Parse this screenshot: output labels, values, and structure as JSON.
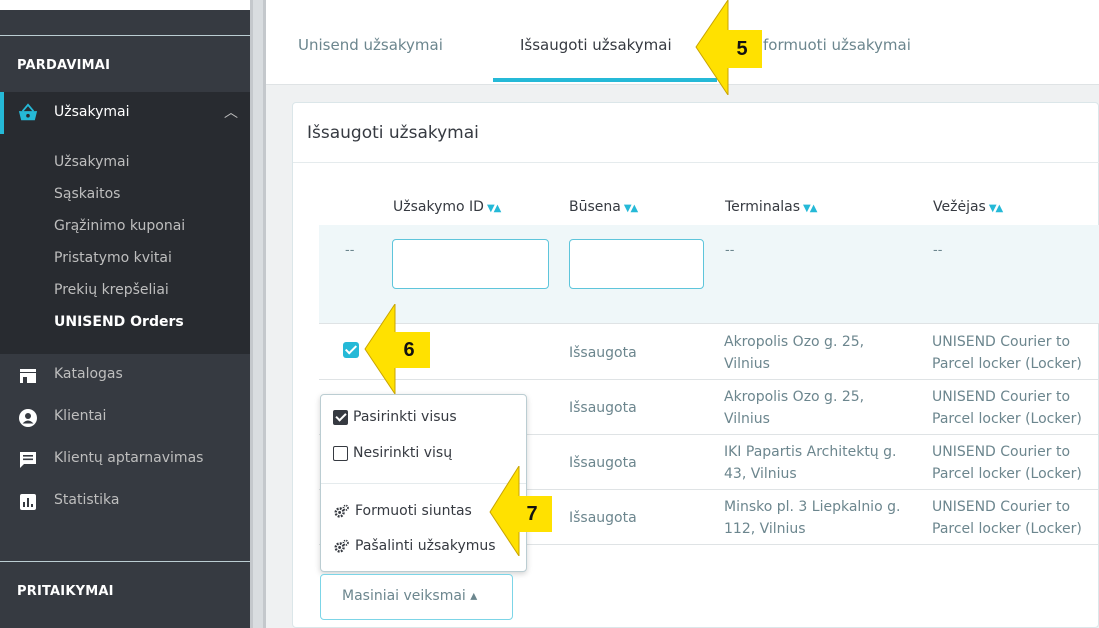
{
  "sidebar": {
    "section_sales": "PARDAVIMAI",
    "active_item": "Užsakymai",
    "submenu": [
      "Užsakymai",
      "Sąskaitos",
      "Grąžinimo kuponai",
      "Pristatymo kvitai",
      "Prekių krepšeliai",
      "UNISEND Orders"
    ],
    "items": [
      {
        "label": "Katalogas",
        "icon": "store-icon"
      },
      {
        "label": "Klientai",
        "icon": "account-icon"
      },
      {
        "label": "Klientų aptarnavimas",
        "icon": "chat-icon"
      },
      {
        "label": "Statistika",
        "icon": "stats-icon"
      }
    ],
    "section_customize": "PRITAIKYMAI"
  },
  "tabs": [
    "Unisend užsakymai",
    "Išsaugoti užsakymai",
    "Suformuoti užsakymai"
  ],
  "panel": {
    "title": "Išsaugoti užsakymai",
    "columns": [
      "Užsakymo ID",
      "Būsena",
      "Terminalas",
      "Vežėjas"
    ],
    "sort_icons": "▼▲",
    "filter_dash": "--",
    "rows": [
      {
        "status": "Išsaugota",
        "terminal_1": "Akropolis Ozo g. 25,",
        "terminal_2": "Vilnius",
        "carrier_1": "UNISEND Courier to",
        "carrier_2": "Parcel locker (Locker)",
        "checked": true
      },
      {
        "status": "Išsaugota",
        "terminal_1": "Akropolis Ozo g. 25,",
        "terminal_2": "Vilnius",
        "carrier_1": "UNISEND Courier to",
        "carrier_2": "Parcel locker (Locker)",
        "checked": false
      },
      {
        "status": "Išsaugota",
        "terminal_1": "IKI Papartis Architektų g.",
        "terminal_2": "43, Vilnius",
        "carrier_1": "UNISEND Courier to",
        "carrier_2": "Parcel locker (Locker)",
        "checked": false
      },
      {
        "status": "Išsaugota",
        "terminal_1": "Minsko pl. 3 Liepkalnio g.",
        "terminal_2": "112, Vilnius",
        "carrier_1": "UNISEND Courier to",
        "carrier_2": "Parcel locker (Locker)",
        "checked": false
      }
    ]
  },
  "dropdown": {
    "select_all": "Pasirinkti visus",
    "deselect_all": "Nesirinkti visų",
    "generate": "Formuoti siuntas",
    "delete": "Pašalinti užsakymus"
  },
  "bulk_button": "Masiniai veiksmai ▴",
  "callouts": [
    "5",
    "6",
    "7"
  ],
  "colors": {
    "accent": "#25b9d7",
    "sidebar": "#363a41",
    "callout": "#ffe100"
  }
}
